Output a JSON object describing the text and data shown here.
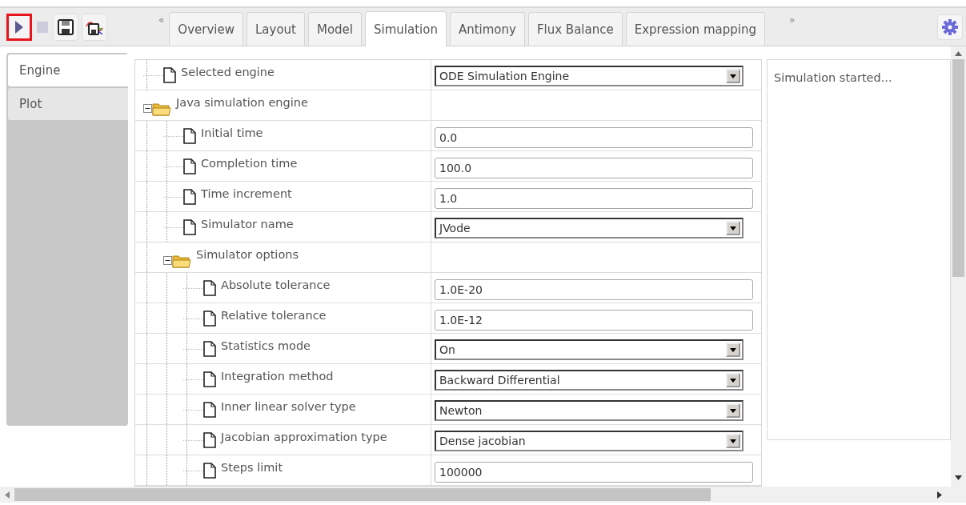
{
  "toolbar": {
    "buttons": [
      {
        "kind": "run",
        "highlighted": true,
        "disabled": false
      },
      {
        "kind": "stop",
        "highlighted": false,
        "disabled": true
      },
      {
        "kind": "save",
        "highlighted": false,
        "disabled": false
      },
      {
        "kind": "export",
        "highlighted": false,
        "disabled": false
      }
    ]
  },
  "tabs": {
    "scroll_left": "«",
    "scroll_right": "»",
    "items": [
      {
        "label": "Overview",
        "selected": false
      },
      {
        "label": "Layout",
        "selected": false
      },
      {
        "label": "Model",
        "selected": false
      },
      {
        "label": "Simulation",
        "selected": true
      },
      {
        "label": "Antimony",
        "selected": false
      },
      {
        "label": "Flux Balance",
        "selected": false
      },
      {
        "label": "Expression mapping",
        "selected": false
      }
    ]
  },
  "sidebar": {
    "items": [
      {
        "label": "Engine",
        "selected": true
      },
      {
        "label": "Plot",
        "selected": false
      }
    ]
  },
  "properties": [
    {
      "kind": "select",
      "name": "Selected engine",
      "value": "ODE Simulation Engine"
    },
    {
      "kind": "group",
      "name": "Java simulation engine",
      "expanded": true,
      "children": [
        {
          "kind": "text",
          "name": "Initial time",
          "value": "0.0"
        },
        {
          "kind": "text",
          "name": "Completion time",
          "value": "100.0"
        },
        {
          "kind": "text",
          "name": "Time increment",
          "value": "1.0"
        },
        {
          "kind": "select",
          "name": "Simulator name",
          "value": "JVode"
        },
        {
          "kind": "group",
          "name": "Simulator options",
          "expanded": true,
          "children": [
            {
              "kind": "text",
              "name": "Absolute tolerance",
              "value": "1.0E-20"
            },
            {
              "kind": "text",
              "name": "Relative tolerance",
              "value": "1.0E-12"
            },
            {
              "kind": "select",
              "name": "Statistics mode",
              "value": "On"
            },
            {
              "kind": "select",
              "name": "Integration method",
              "value": "Backward Differential"
            },
            {
              "kind": "select",
              "name": "Inner linear solver type",
              "value": "Newton"
            },
            {
              "kind": "select",
              "name": "Jacobian approximation type",
              "value": "Dense jacobian"
            },
            {
              "kind": "text",
              "name": "Steps limit",
              "value": "100000"
            }
          ]
        }
      ]
    }
  ],
  "log": {
    "text": "Simulation started..."
  }
}
